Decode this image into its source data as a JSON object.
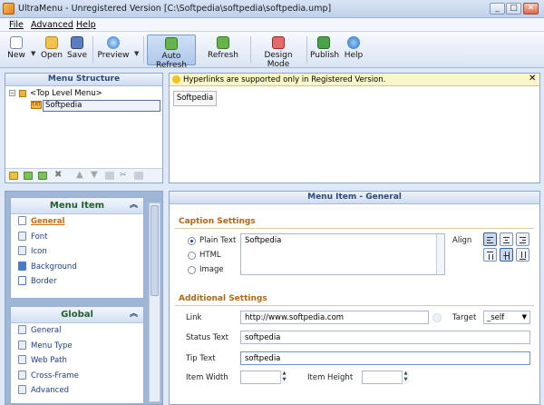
{
  "window": {
    "title": "UltraMenu - Unregistered Version [C:\\Softpedia\\softpedia\\softpedia.ump]"
  },
  "menubar": {
    "items": [
      "File",
      "Advanced",
      "Help"
    ]
  },
  "toolbar": {
    "new": "New",
    "open": "Open",
    "save": "Save",
    "preview": "Preview",
    "auto_refresh": "Auto Refresh",
    "refresh": "Refresh",
    "design_mode": "Design Mode",
    "publish": "Publish",
    "help": "Help"
  },
  "menu_structure": {
    "title": "Menu Structure",
    "root": "<Top Level Menu>",
    "child": "Softpedia"
  },
  "notice": {
    "text": "Hyperlinks are supported only in Registered Version."
  },
  "preview": {
    "item": "Softpedia"
  },
  "sidebar": {
    "menu_item": {
      "title": "Menu Item",
      "items": [
        "General",
        "Font",
        "Icon",
        "Background",
        "Border"
      ]
    },
    "global": {
      "title": "Global",
      "items": [
        "General",
        "Menu Type",
        "Web Path",
        "Cross-Frame",
        "Advanced"
      ]
    }
  },
  "main": {
    "title": "Menu Item - General",
    "caption": {
      "heading": "Caption Settings",
      "options": [
        "Plain Text",
        "HTML",
        "Image"
      ],
      "selected": "Plain Text",
      "text": "Softpedia",
      "align_label": "Align"
    },
    "additional": {
      "heading": "Additional Settings",
      "link_label": "Link",
      "link_value": "http://www.softpedia.com",
      "target_label": "Target",
      "target_value": "_self",
      "status_label": "Status Text",
      "status_value": "softpedia",
      "tip_label": "Tip Text",
      "tip_value": "softpedia",
      "width_label": "Item Width",
      "height_label": "Item Height"
    }
  },
  "colors": {
    "accent": "#2c4a78",
    "section": "#b66612",
    "notice_bg": "#fbf6c7"
  }
}
